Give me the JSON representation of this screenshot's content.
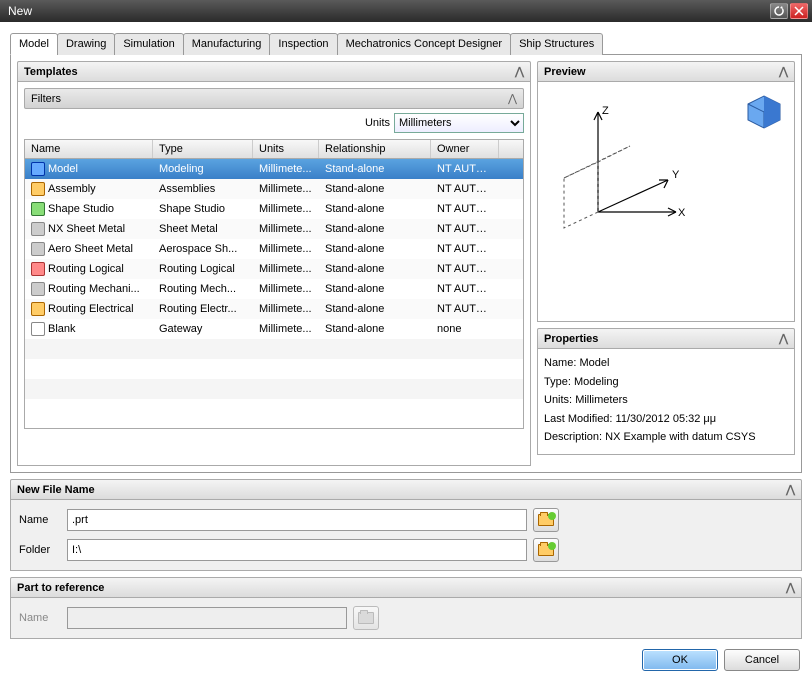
{
  "window": {
    "title": "New"
  },
  "tabs": [
    "Model",
    "Drawing",
    "Simulation",
    "Manufacturing",
    "Inspection",
    "Mechatronics Concept Designer",
    "Ship Structures"
  ],
  "active_tab": 0,
  "templates": {
    "header": "Templates",
    "filters_header": "Filters",
    "units_label": "Units",
    "units_value": "Millimeters",
    "columns": {
      "name": "Name",
      "type": "Type",
      "units": "Units",
      "rel": "Relationship",
      "owner": "Owner"
    },
    "rows": [
      {
        "name": "Model",
        "type": "Modeling",
        "units": "Millimete...",
        "rel": "Stand-alone",
        "owner": "NT AUTH...",
        "icon": "blue",
        "selected": true
      },
      {
        "name": "Assembly",
        "type": "Assemblies",
        "units": "Millimete...",
        "rel": "Stand-alone",
        "owner": "NT AUTH...",
        "icon": "yellow"
      },
      {
        "name": "Shape Studio",
        "type": "Shape Studio",
        "units": "Millimete...",
        "rel": "Stand-alone",
        "owner": "NT AUTH...",
        "icon": "green"
      },
      {
        "name": "NX Sheet Metal",
        "type": "Sheet Metal",
        "units": "Millimete...",
        "rel": "Stand-alone",
        "owner": "NT AUTH...",
        "icon": "grey"
      },
      {
        "name": "Aero Sheet Metal",
        "type": "Aerospace Sh...",
        "units": "Millimete...",
        "rel": "Stand-alone",
        "owner": "NT AUTH...",
        "icon": "grey"
      },
      {
        "name": "Routing Logical",
        "type": "Routing Logical",
        "units": "Millimete...",
        "rel": "Stand-alone",
        "owner": "NT AUTH...",
        "icon": "red"
      },
      {
        "name": "Routing Mechani...",
        "type": "Routing Mech...",
        "units": "Millimete...",
        "rel": "Stand-alone",
        "owner": "NT AUTH...",
        "icon": "grey"
      },
      {
        "name": "Routing Electrical",
        "type": "Routing Electr...",
        "units": "Millimete...",
        "rel": "Stand-alone",
        "owner": "NT AUTH...",
        "icon": "yellow"
      },
      {
        "name": "Blank",
        "type": "Gateway",
        "units": "Millimete...",
        "rel": "Stand-alone",
        "owner": "none",
        "icon": "white"
      }
    ]
  },
  "preview": {
    "header": "Preview"
  },
  "properties": {
    "header": "Properties",
    "name_label": "Name:",
    "name_value": "Model",
    "type_label": "Type:",
    "type_value": "Modeling",
    "units_label": "Units:",
    "units_value": "Millimeters",
    "lm_label": "Last Modified:",
    "lm_value": "11/30/2012 05:32 μμ",
    "desc_label": "Description:",
    "desc_value": "NX Example with datum CSYS"
  },
  "new_file": {
    "header": "New File Name",
    "name_label": "Name",
    "name_value": ".prt",
    "folder_label": "Folder",
    "folder_value": "I:\\"
  },
  "part_ref": {
    "header": "Part to reference",
    "name_label": "Name",
    "name_value": ""
  },
  "footer": {
    "ok": "OK",
    "cancel": "Cancel"
  }
}
